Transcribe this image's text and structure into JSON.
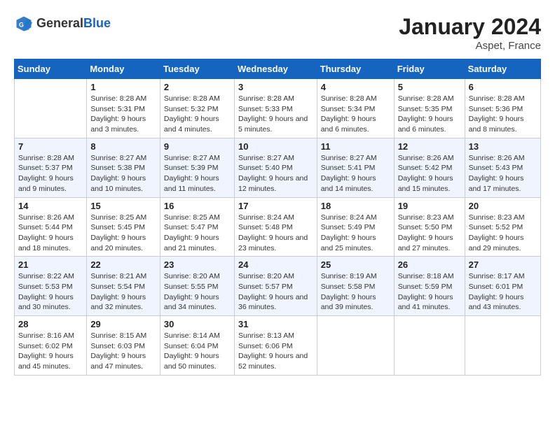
{
  "header": {
    "logo_general": "General",
    "logo_blue": "Blue",
    "title": "January 2024",
    "subtitle": "Aspet, France"
  },
  "columns": [
    "Sunday",
    "Monday",
    "Tuesday",
    "Wednesday",
    "Thursday",
    "Friday",
    "Saturday"
  ],
  "weeks": [
    [
      {
        "day": "",
        "sunrise": "",
        "sunset": "",
        "daylight": ""
      },
      {
        "day": "1",
        "sunrise": "Sunrise: 8:28 AM",
        "sunset": "Sunset: 5:31 PM",
        "daylight": "Daylight: 9 hours and 3 minutes."
      },
      {
        "day": "2",
        "sunrise": "Sunrise: 8:28 AM",
        "sunset": "Sunset: 5:32 PM",
        "daylight": "Daylight: 9 hours and 4 minutes."
      },
      {
        "day": "3",
        "sunrise": "Sunrise: 8:28 AM",
        "sunset": "Sunset: 5:33 PM",
        "daylight": "Daylight: 9 hours and 5 minutes."
      },
      {
        "day": "4",
        "sunrise": "Sunrise: 8:28 AM",
        "sunset": "Sunset: 5:34 PM",
        "daylight": "Daylight: 9 hours and 6 minutes."
      },
      {
        "day": "5",
        "sunrise": "Sunrise: 8:28 AM",
        "sunset": "Sunset: 5:35 PM",
        "daylight": "Daylight: 9 hours and 6 minutes."
      },
      {
        "day": "6",
        "sunrise": "Sunrise: 8:28 AM",
        "sunset": "Sunset: 5:36 PM",
        "daylight": "Daylight: 9 hours and 8 minutes."
      }
    ],
    [
      {
        "day": "7",
        "sunrise": "Sunrise: 8:28 AM",
        "sunset": "Sunset: 5:37 PM",
        "daylight": "Daylight: 9 hours and 9 minutes."
      },
      {
        "day": "8",
        "sunrise": "Sunrise: 8:27 AM",
        "sunset": "Sunset: 5:38 PM",
        "daylight": "Daylight: 9 hours and 10 minutes."
      },
      {
        "day": "9",
        "sunrise": "Sunrise: 8:27 AM",
        "sunset": "Sunset: 5:39 PM",
        "daylight": "Daylight: 9 hours and 11 minutes."
      },
      {
        "day": "10",
        "sunrise": "Sunrise: 8:27 AM",
        "sunset": "Sunset: 5:40 PM",
        "daylight": "Daylight: 9 hours and 12 minutes."
      },
      {
        "day": "11",
        "sunrise": "Sunrise: 8:27 AM",
        "sunset": "Sunset: 5:41 PM",
        "daylight": "Daylight: 9 hours and 14 minutes."
      },
      {
        "day": "12",
        "sunrise": "Sunrise: 8:26 AM",
        "sunset": "Sunset: 5:42 PM",
        "daylight": "Daylight: 9 hours and 15 minutes."
      },
      {
        "day": "13",
        "sunrise": "Sunrise: 8:26 AM",
        "sunset": "Sunset: 5:43 PM",
        "daylight": "Daylight: 9 hours and 17 minutes."
      }
    ],
    [
      {
        "day": "14",
        "sunrise": "Sunrise: 8:26 AM",
        "sunset": "Sunset: 5:44 PM",
        "daylight": "Daylight: 9 hours and 18 minutes."
      },
      {
        "day": "15",
        "sunrise": "Sunrise: 8:25 AM",
        "sunset": "Sunset: 5:45 PM",
        "daylight": "Daylight: 9 hours and 20 minutes."
      },
      {
        "day": "16",
        "sunrise": "Sunrise: 8:25 AM",
        "sunset": "Sunset: 5:47 PM",
        "daylight": "Daylight: 9 hours and 21 minutes."
      },
      {
        "day": "17",
        "sunrise": "Sunrise: 8:24 AM",
        "sunset": "Sunset: 5:48 PM",
        "daylight": "Daylight: 9 hours and 23 minutes."
      },
      {
        "day": "18",
        "sunrise": "Sunrise: 8:24 AM",
        "sunset": "Sunset: 5:49 PM",
        "daylight": "Daylight: 9 hours and 25 minutes."
      },
      {
        "day": "19",
        "sunrise": "Sunrise: 8:23 AM",
        "sunset": "Sunset: 5:50 PM",
        "daylight": "Daylight: 9 hours and 27 minutes."
      },
      {
        "day": "20",
        "sunrise": "Sunrise: 8:23 AM",
        "sunset": "Sunset: 5:52 PM",
        "daylight": "Daylight: 9 hours and 29 minutes."
      }
    ],
    [
      {
        "day": "21",
        "sunrise": "Sunrise: 8:22 AM",
        "sunset": "Sunset: 5:53 PM",
        "daylight": "Daylight: 9 hours and 30 minutes."
      },
      {
        "day": "22",
        "sunrise": "Sunrise: 8:21 AM",
        "sunset": "Sunset: 5:54 PM",
        "daylight": "Daylight: 9 hours and 32 minutes."
      },
      {
        "day": "23",
        "sunrise": "Sunrise: 8:20 AM",
        "sunset": "Sunset: 5:55 PM",
        "daylight": "Daylight: 9 hours and 34 minutes."
      },
      {
        "day": "24",
        "sunrise": "Sunrise: 8:20 AM",
        "sunset": "Sunset: 5:57 PM",
        "daylight": "Daylight: 9 hours and 36 minutes."
      },
      {
        "day": "25",
        "sunrise": "Sunrise: 8:19 AM",
        "sunset": "Sunset: 5:58 PM",
        "daylight": "Daylight: 9 hours and 39 minutes."
      },
      {
        "day": "26",
        "sunrise": "Sunrise: 8:18 AM",
        "sunset": "Sunset: 5:59 PM",
        "daylight": "Daylight: 9 hours and 41 minutes."
      },
      {
        "day": "27",
        "sunrise": "Sunrise: 8:17 AM",
        "sunset": "Sunset: 6:01 PM",
        "daylight": "Daylight: 9 hours and 43 minutes."
      }
    ],
    [
      {
        "day": "28",
        "sunrise": "Sunrise: 8:16 AM",
        "sunset": "Sunset: 6:02 PM",
        "daylight": "Daylight: 9 hours and 45 minutes."
      },
      {
        "day": "29",
        "sunrise": "Sunrise: 8:15 AM",
        "sunset": "Sunset: 6:03 PM",
        "daylight": "Daylight: 9 hours and 47 minutes."
      },
      {
        "day": "30",
        "sunrise": "Sunrise: 8:14 AM",
        "sunset": "Sunset: 6:04 PM",
        "daylight": "Daylight: 9 hours and 50 minutes."
      },
      {
        "day": "31",
        "sunrise": "Sunrise: 8:13 AM",
        "sunset": "Sunset: 6:06 PM",
        "daylight": "Daylight: 9 hours and 52 minutes."
      },
      {
        "day": "",
        "sunrise": "",
        "sunset": "",
        "daylight": ""
      },
      {
        "day": "",
        "sunrise": "",
        "sunset": "",
        "daylight": ""
      },
      {
        "day": "",
        "sunrise": "",
        "sunset": "",
        "daylight": ""
      }
    ]
  ]
}
